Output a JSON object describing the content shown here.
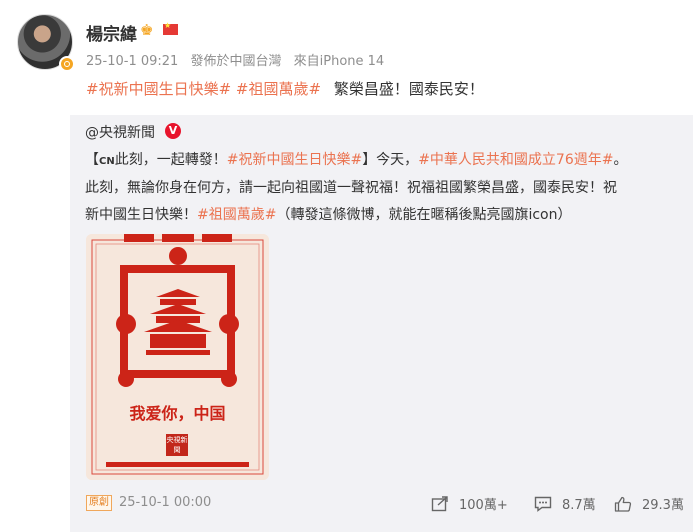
{
  "author": {
    "name": "楊宗緯",
    "crown_icon": "crown-icon",
    "flag_icon": "china-flag-icon"
  },
  "meta": {
    "time": "25-10-1 09:21",
    "location": "發佈於中國台灣",
    "device": "來自iPhone 14"
  },
  "post": {
    "tag1": "#祝新中國生日快樂#",
    "tag2": "#祖國萬歲#",
    "text": "繁榮昌盛！國泰民安！"
  },
  "repost": {
    "author": "@央視新聞",
    "badge": "V",
    "line1_pre": "【",
    "cn_label": "CN",
    "line1_a": "此刻，一起轉發！",
    "tag_a": "#祝新中國生日快樂#",
    "line1_b": "】今天，",
    "tag_b": "#中華人民共和國成立76週年#",
    "line1_c": "。",
    "line2": "此刻，無論你身在何方，請一起向祖國道一聲祝福！祝福祖國繁榮昌盛，國泰民安！祝",
    "line3_a": "新中國生日快樂！",
    "tag_c": "#祖國萬歲#",
    "line3_b": "（轉發這條微博，就能在暱稱後點亮國旗icon）",
    "poster_caption": "我爱你，中国",
    "poster_logo": "央視新聞"
  },
  "footer": {
    "original_label": "原創",
    "time": "25-10-1 00:00",
    "repost_count": "100萬+",
    "comment_count": "8.7萬",
    "like_count": "29.3萬"
  },
  "colors": {
    "tag": "#eb7350",
    "repost_bg": "#f2f2f5",
    "poster_red": "#cc2418"
  }
}
